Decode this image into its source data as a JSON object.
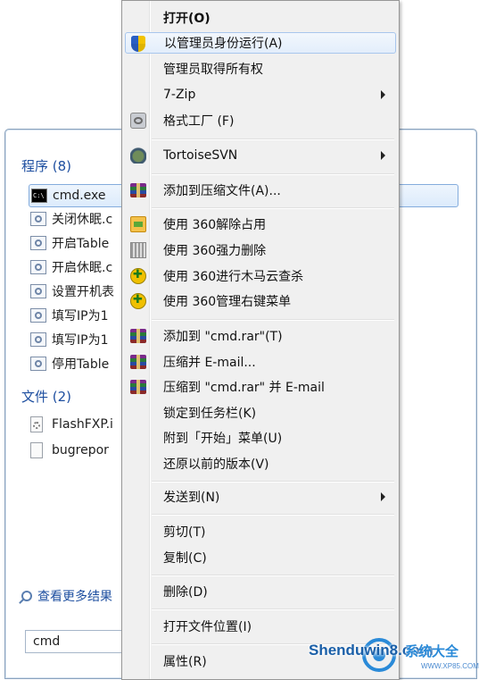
{
  "start_menu": {
    "programs_header": "程序 (8)",
    "programs": [
      {
        "label": "cmd.exe",
        "icon": "cmd-icon",
        "selected": true
      },
      {
        "label": "关闭休眠.c",
        "icon": "script-icon"
      },
      {
        "label": "开启Table",
        "icon": "script-icon"
      },
      {
        "label": "开启休眠.c",
        "icon": "script-icon"
      },
      {
        "label": "设置开机表",
        "icon": "script-icon"
      },
      {
        "label": "填写IP为1",
        "icon": "script-icon"
      },
      {
        "label": "填写IP为1",
        "icon": "script-icon"
      },
      {
        "label": "停用Table",
        "icon": "script-icon"
      }
    ],
    "files_header": "文件 (2)",
    "files": [
      {
        "label": "FlashFXP.i",
        "icon": "settings-file-icon"
      },
      {
        "label": "bugrepor",
        "icon": "document-icon"
      }
    ],
    "see_more": "查看更多结果",
    "search_value": "cmd"
  },
  "context_menu": {
    "items": [
      {
        "label": "打开(O)",
        "bold": true
      },
      {
        "label": "以管理员身份运行(A)",
        "icon": "uac-shield-icon",
        "highlighted": true
      },
      {
        "label": "管理员取得所有权"
      },
      {
        "label": "7-Zip",
        "submenu": true
      },
      {
        "label": "格式工厂 (F)",
        "icon": "format-factory-icon"
      },
      {
        "label": "TortoiseSVN",
        "icon": "tortoise-svn-icon",
        "submenu": true
      },
      {
        "label": "添加到压缩文件(A)...",
        "icon": "winrar-icon"
      },
      {
        "label": "使用 360解除占用",
        "icon": "unlock-icon"
      },
      {
        "label": "使用 360强力删除",
        "icon": "shredder-icon"
      },
      {
        "label": "使用 360进行木马云查杀",
        "icon": "trojan-scan-icon"
      },
      {
        "label": "使用 360管理右键菜单",
        "icon": "trojan-scan-icon"
      },
      {
        "label": "添加到 \"cmd.rar\"(T)",
        "icon": "winrar-icon"
      },
      {
        "label": "压缩并 E-mail...",
        "icon": "winrar-icon"
      },
      {
        "label": "压缩到 \"cmd.rar\" 并 E-mail",
        "icon": "winrar-icon"
      },
      {
        "label": "锁定到任务栏(K)"
      },
      {
        "label": "附到「开始」菜单(U)"
      },
      {
        "label": "还原以前的版本(V)"
      },
      {
        "label": "发送到(N)",
        "submenu": true
      },
      {
        "label": "剪切(T)"
      },
      {
        "label": "复制(C)"
      },
      {
        "label": "删除(D)"
      },
      {
        "label": "打开文件位置(I)"
      },
      {
        "label": "属性(R)"
      }
    ]
  },
  "watermark": {
    "text": "Shenduwin8.com",
    "cn_text": "系统大全",
    "url": "WWW.XP85.COM"
  },
  "colors": {
    "menu_bg": "#f0f0f0",
    "highlight_border": "#a8c6ed",
    "section_header": "#1e4fa0"
  }
}
